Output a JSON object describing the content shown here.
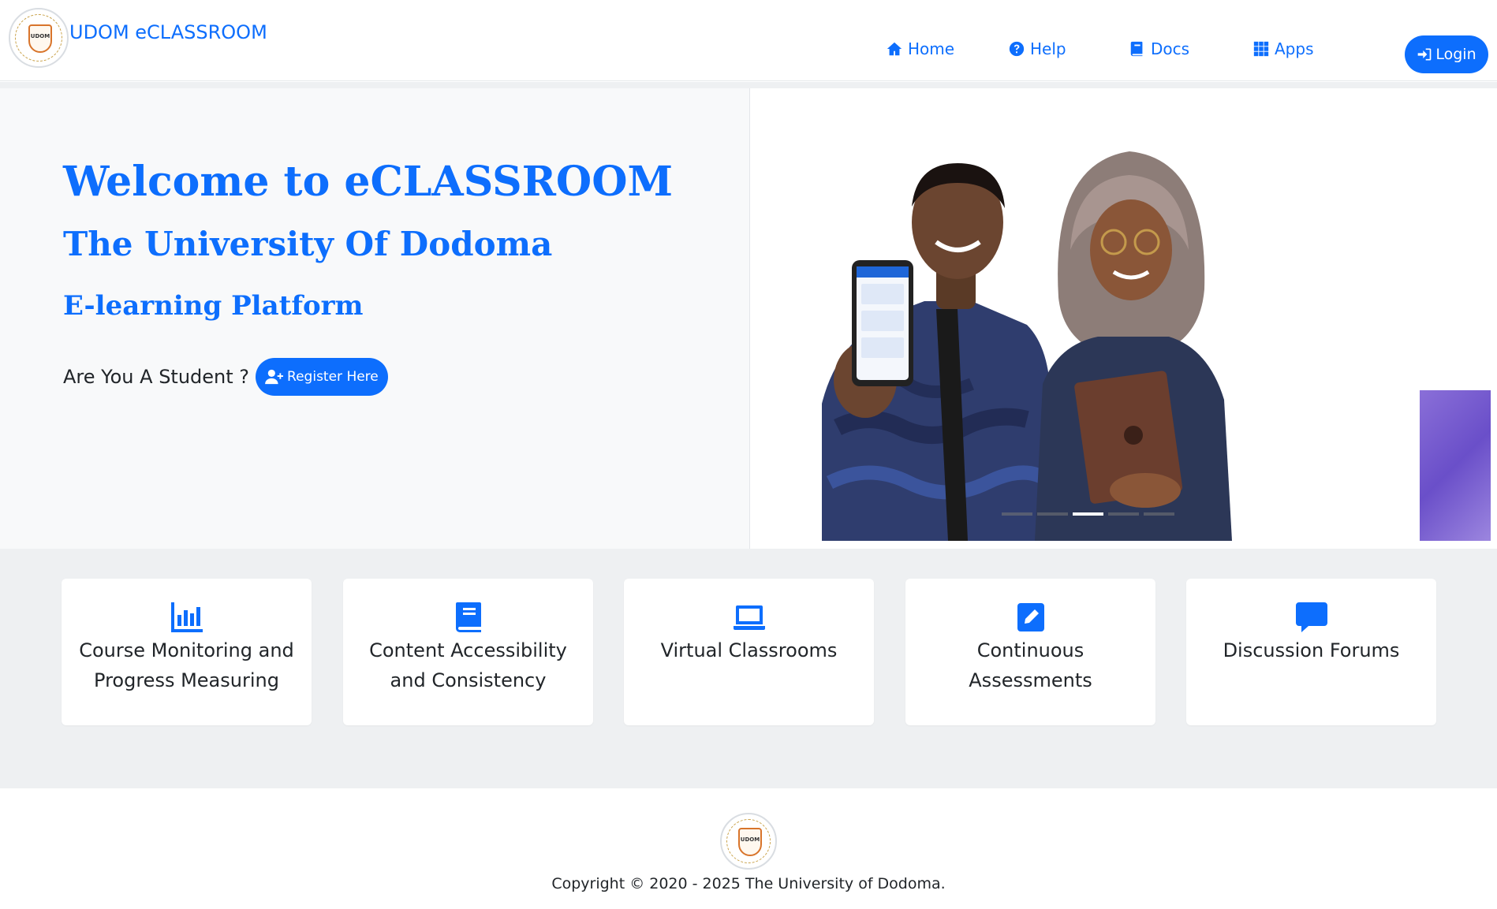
{
  "header": {
    "brand_title": "UDOM eCLASSROOM",
    "logo_text": "UDOM",
    "nav": [
      {
        "label": "Home",
        "icon": "home-icon"
      },
      {
        "label": "Help",
        "icon": "question-circle-icon"
      },
      {
        "label": "Docs",
        "icon": "book-icon"
      },
      {
        "label": "Apps",
        "icon": "grid-icon"
      }
    ],
    "login_label": "Login"
  },
  "hero": {
    "title": "Welcome to eCLASSROOM",
    "subtitle": "The University Of Dodoma",
    "tagline": "E-learning Platform",
    "student_question": "Are You A Student ?",
    "register_label": "Register Here",
    "carousel_slide_count": 5,
    "carousel_active_index": 2
  },
  "features": [
    {
      "label": "Course Monitoring and Progress Measuring",
      "icon": "bar-chart-icon"
    },
    {
      "label": "Content Accessibility and Consistency",
      "icon": "book-icon"
    },
    {
      "label": "Virtual Classrooms",
      "icon": "laptop-icon"
    },
    {
      "label": "Continuous Assessments",
      "icon": "pencil-square-icon"
    },
    {
      "label": "Discussion Forums",
      "icon": "chat-bubble-icon"
    }
  ],
  "footer": {
    "copyright": "Copyright © 2020 - 2025   The University of Dodoma."
  },
  "colors": {
    "primary": "#0d6efd",
    "page_bg": "#eef0f2",
    "hero_bg": "#f8f9fa"
  }
}
